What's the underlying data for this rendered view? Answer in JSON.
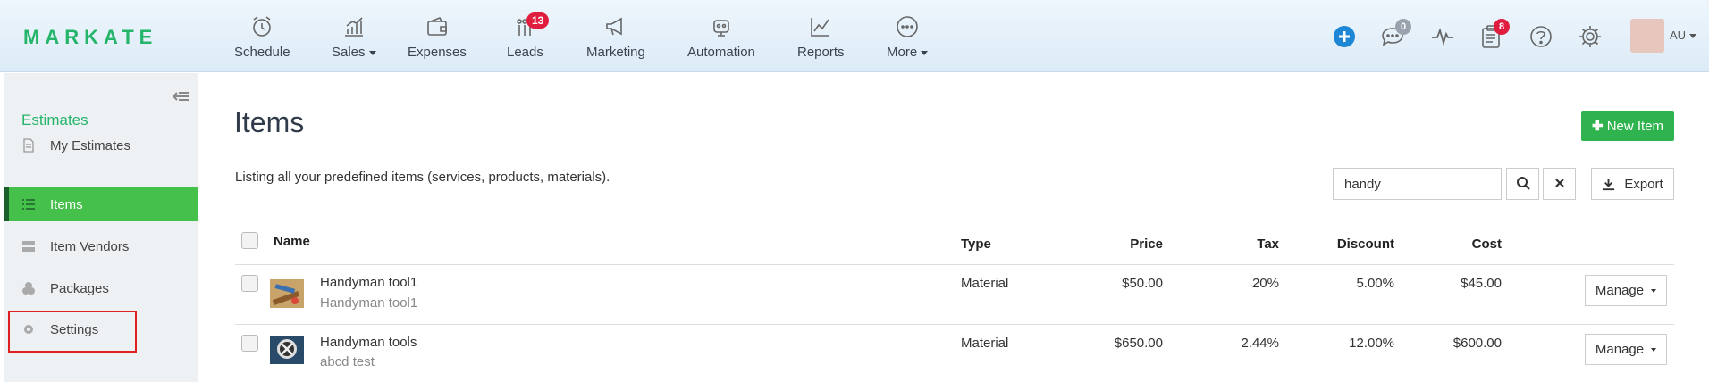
{
  "app": {
    "logo": "MARKATE"
  },
  "nav": [
    {
      "label": "Schedule",
      "icon": "alarm-clock-icon"
    },
    {
      "label": "Sales",
      "icon": "bar-chart-icon",
      "dropdown": true
    },
    {
      "label": "Expenses",
      "icon": "wallet-icon"
    },
    {
      "label": "Leads",
      "icon": "leads-icon",
      "badge": "13"
    },
    {
      "label": "Marketing",
      "icon": "megaphone-icon"
    },
    {
      "label": "Automation",
      "icon": "robot-icon"
    },
    {
      "label": "Reports",
      "icon": "line-chart-icon"
    },
    {
      "label": "More",
      "icon": "more-dots-icon",
      "dropdown": true
    }
  ],
  "toolbar": {
    "chat_badge": "0",
    "tasks_badge": "8",
    "user_initials": "AU"
  },
  "sidebar": {
    "title": "Estimates",
    "items": [
      {
        "label": "My Estimates",
        "icon": "document-icon"
      },
      {
        "label": "Items",
        "icon": "list-icon",
        "active": true
      },
      {
        "label": "Item Vendors",
        "icon": "server-icon"
      },
      {
        "label": "Packages",
        "icon": "boxes-icon"
      },
      {
        "label": "Settings",
        "icon": "gear-icon"
      }
    ]
  },
  "main": {
    "title": "Items",
    "subtitle": "Listing all your predefined items (services, products, materials).",
    "new_button": "New Item",
    "search_value": "handy",
    "export_label": "Export"
  },
  "table": {
    "headers": {
      "name": "Name",
      "type": "Type",
      "price": "Price",
      "tax": "Tax",
      "discount": "Discount",
      "cost": "Cost"
    },
    "rows": [
      {
        "name": "Handyman tool1",
        "description": "Handyman tool1",
        "type": "Material",
        "price": "$50.00",
        "tax": "20%",
        "discount": "5.00%",
        "cost": "$45.00",
        "manage": "Manage"
      },
      {
        "name": "Handyman tools",
        "description": "abcd test",
        "type": "Material",
        "price": "$650.00",
        "tax": "2.44%",
        "discount": "12.00%",
        "cost": "$600.00",
        "manage": "Manage"
      }
    ]
  },
  "colors": {
    "brand": "#25b56a",
    "active": "#44c04b",
    "badge": "#e11d3f",
    "plus": "#1d87d6"
  }
}
